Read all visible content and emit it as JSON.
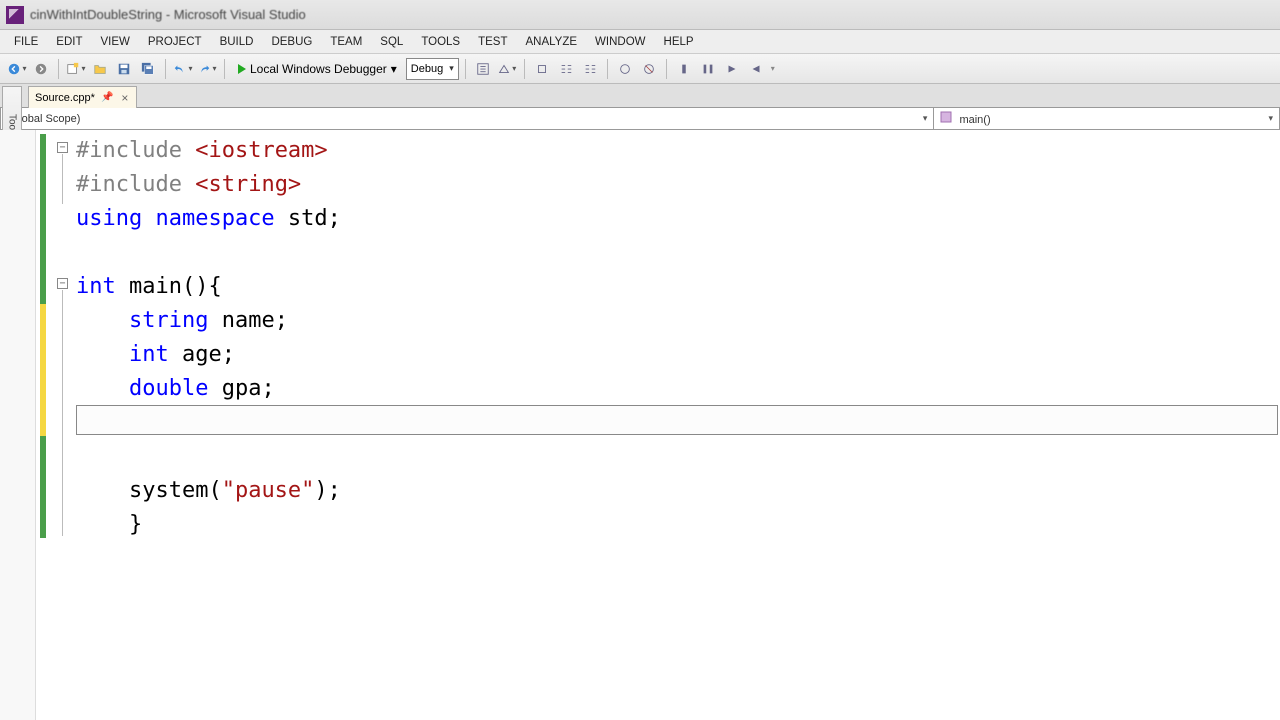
{
  "title": "cinWithIntDoubleString - Microsoft Visual Studio",
  "menu": [
    "FILE",
    "EDIT",
    "VIEW",
    "PROJECT",
    "BUILD",
    "DEBUG",
    "TEAM",
    "SQL",
    "TOOLS",
    "TEST",
    "ANALYZE",
    "WINDOW",
    "HELP"
  ],
  "toolbar": {
    "debugger_label": "Local Windows Debugger",
    "config": "Debug"
  },
  "toolbox_label": "Toolbox",
  "tab": {
    "name": "Source.cpp*",
    "close": "×"
  },
  "nav": {
    "scope": "(Global Scope)",
    "member": "main()"
  },
  "code": {
    "lines": [
      {
        "segments": [
          {
            "t": "#include ",
            "c": "kw-pre"
          },
          {
            "t": "<iostream>",
            "c": "str"
          }
        ],
        "fold": true
      },
      {
        "segments": [
          {
            "t": "#include ",
            "c": "kw-pre"
          },
          {
            "t": "<string>",
            "c": "str"
          }
        ]
      },
      {
        "segments": [
          {
            "t": "using namespace ",
            "c": "kw-blue"
          },
          {
            "t": "std;",
            "c": ""
          }
        ]
      },
      {
        "segments": []
      },
      {
        "segments": [
          {
            "t": "int ",
            "c": "kw-blue"
          },
          {
            "t": "main(){",
            "c": ""
          }
        ],
        "fold": true
      },
      {
        "segments": [
          {
            "t": "    ",
            "c": ""
          },
          {
            "t": "string",
            "c": "kw-blue"
          },
          {
            "t": " name;",
            "c": ""
          }
        ]
      },
      {
        "segments": [
          {
            "t": "    ",
            "c": ""
          },
          {
            "t": "int",
            "c": "kw-blue"
          },
          {
            "t": " age;",
            "c": ""
          }
        ]
      },
      {
        "segments": [
          {
            "t": "    ",
            "c": ""
          },
          {
            "t": "double",
            "c": "kw-blue"
          },
          {
            "t": " gpa;",
            "c": ""
          }
        ]
      },
      {
        "segments": [],
        "current": true
      },
      {
        "segments": []
      },
      {
        "segments": [
          {
            "t": "    system(",
            "c": ""
          },
          {
            "t": "\"pause\"",
            "c": "str"
          },
          {
            "t": ");",
            "c": ""
          }
        ]
      },
      {
        "segments": [
          {
            "t": "    }",
            "c": ""
          }
        ]
      }
    ]
  }
}
